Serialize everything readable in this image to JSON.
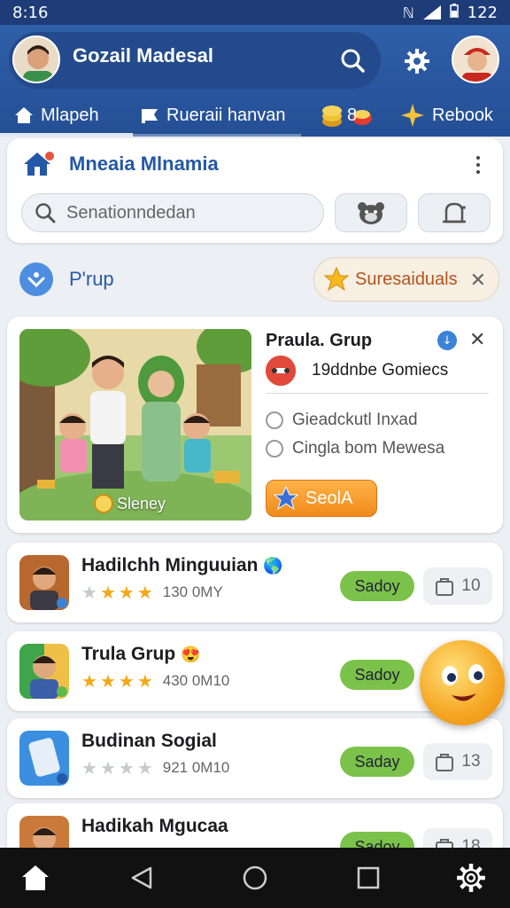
{
  "status_bar": {
    "time": "8:16",
    "battery": "122"
  },
  "header": {
    "username": "Gozail Madesal",
    "tabs": [
      {
        "label": "Mlapeh",
        "icon": "home-icon"
      },
      {
        "label": "Rueraii hanvan",
        "icon": "flag-icon"
      },
      {
        "label": "8",
        "icon": "coins-icon"
      },
      {
        "label": "Rebook",
        "icon": "sparkle-icon"
      }
    ]
  },
  "search_card": {
    "title": "Mneaia Mlnamia",
    "search_placeholder": "Senationndedan"
  },
  "group_row": {
    "label": "P'rup",
    "chip_label": "Suresaiduals"
  },
  "feature": {
    "title": "Praula. Grup",
    "subtitle": "19ddnbe Gomiecs",
    "image_caption": "Sleney",
    "options": [
      "Gieadckutl Inxad",
      "Cingla bom Mewesa"
    ],
    "action_label": "SeolA"
  },
  "items": [
    {
      "title": "Hadilchh Minguuian",
      "rating": 3,
      "meta": "130 0MY",
      "action": "Sadoy",
      "count": "10"
    },
    {
      "title": "Trula Grup",
      "rating": 4,
      "meta": "430 0M10",
      "action": "Sadoy",
      "count": ""
    },
    {
      "title": "Budinan Sogial",
      "rating": 0,
      "meta": "921 0M10",
      "action": "Saday",
      "count": "13"
    },
    {
      "title": "Hadikah Mgucaa",
      "rating": 0,
      "meta": "",
      "action": "Sadoy",
      "count": "18"
    }
  ],
  "colors": {
    "header": "#2f5fa8",
    "accent": "#2458a6",
    "action_green": "#7bc24a",
    "action_orange": "#f08a1c"
  }
}
